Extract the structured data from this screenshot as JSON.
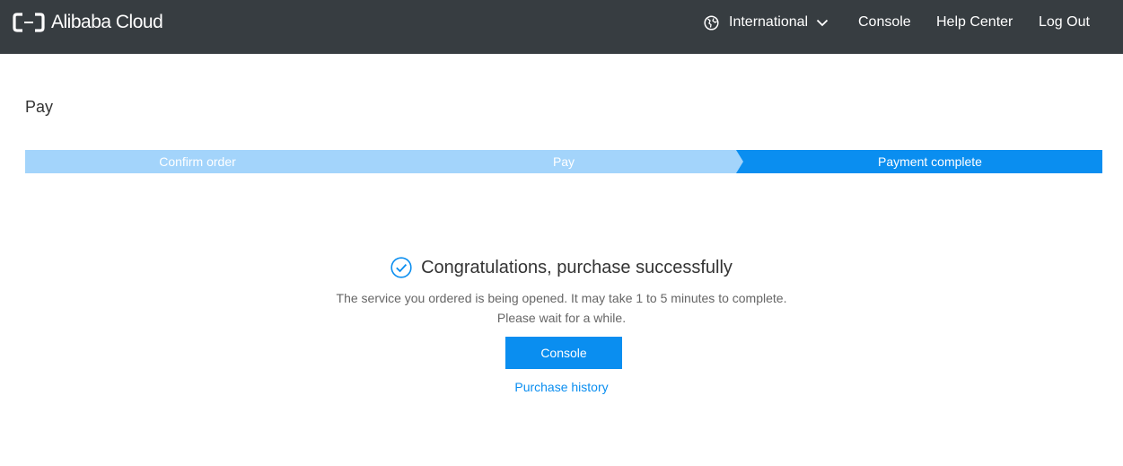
{
  "header": {
    "logo_text": "Alibaba Cloud",
    "region_label": "International",
    "console_label": "Console",
    "help_label": "Help Center",
    "logout_label": "Log Out",
    "background_color": "#373d41"
  },
  "page": {
    "title": "Pay"
  },
  "steps": {
    "items": [
      {
        "label": "Confirm order",
        "state": "done"
      },
      {
        "label": "Pay",
        "state": "done"
      },
      {
        "label": "Payment complete",
        "state": "current"
      }
    ],
    "done_color": "#a3d4fb",
    "current_color": "#0a8ef0"
  },
  "result": {
    "icon": "check-circle-icon",
    "title": "Congratulations, purchase successfully",
    "message_line1": "The service you ordered is being opened. It may take 1 to 5 minutes to complete.",
    "message_line2": "Please wait for a while.",
    "console_button": "Console",
    "history_link": "Purchase history"
  },
  "accent_color": "#0a8ef0"
}
